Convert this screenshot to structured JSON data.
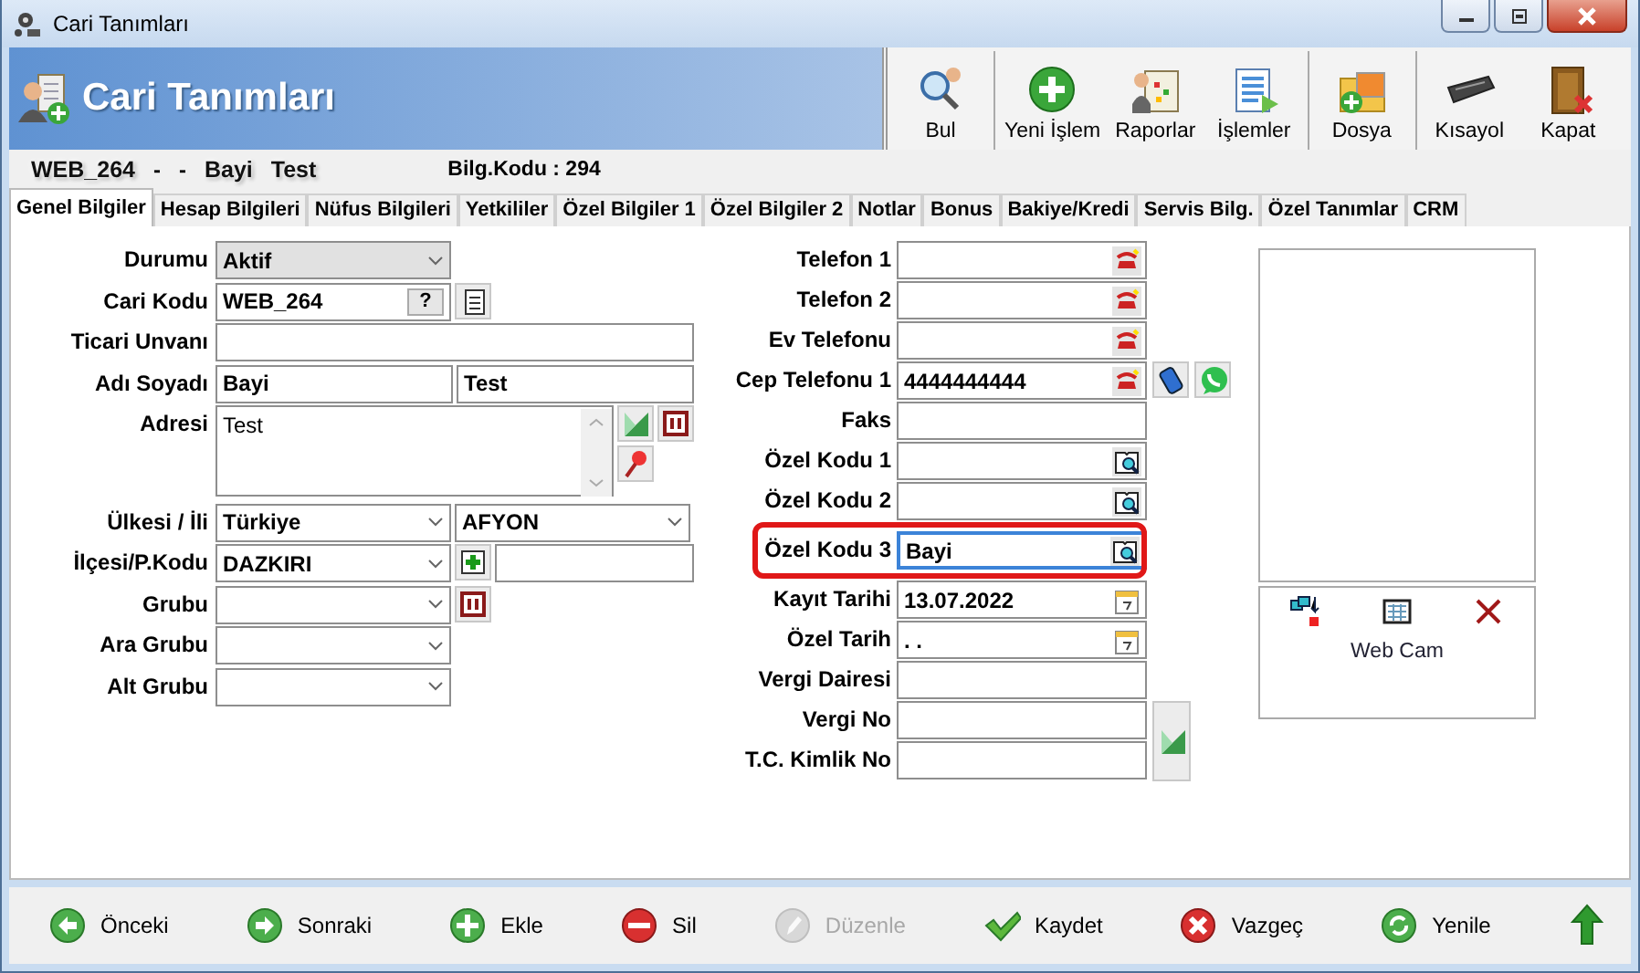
{
  "window": {
    "title": "Cari Tanımları"
  },
  "header": {
    "title": "Cari Tanımları"
  },
  "toolbar_groups": [
    {
      "buttons": [
        {
          "kind": "search",
          "label": "Bul"
        }
      ]
    },
    {
      "buttons": [
        {
          "kind": "add",
          "label": "Yeni İşlem"
        },
        {
          "kind": "report",
          "label": "Raporlar"
        },
        {
          "kind": "list",
          "label": "İşlemler"
        }
      ]
    },
    {
      "buttons": [
        {
          "kind": "file",
          "label": "Dosya"
        }
      ]
    },
    {
      "buttons": [
        {
          "kind": "keyboard",
          "label": "Kısayol"
        },
        {
          "kind": "door",
          "label": "Kapat"
        }
      ]
    }
  ],
  "summary": [
    {
      "kind": "glow",
      "text": "WEB_264"
    },
    {
      "kind": "plain",
      "text": "-"
    },
    {
      "kind": "plain",
      "text": "-"
    },
    {
      "kind": "glow",
      "text": "Bayi"
    },
    {
      "kind": "glow",
      "text": "Test"
    },
    {
      "kind": "info",
      "text": "Bilg.Kodu : 294"
    }
  ],
  "tabs": [
    {
      "label": "Genel Bilgiler",
      "selected": true
    },
    {
      "label": "Hesap Bilgileri",
      "selected": false
    },
    {
      "label": "Nüfus Bilgileri",
      "selected": false
    },
    {
      "label": "Yetkililer",
      "selected": false
    },
    {
      "label": "Özel Bilgiler 1",
      "selected": false
    },
    {
      "label": "Özel Bilgiler 2",
      "selected": false
    },
    {
      "label": "Notlar",
      "selected": false
    },
    {
      "label": "Bonus",
      "selected": false
    },
    {
      "label": "Bakiye/Kredi",
      "selected": false
    },
    {
      "label": "Servis Bilg.",
      "selected": false
    },
    {
      "label": "Özel Tanımlar",
      "selected": false
    },
    {
      "label": "CRM",
      "selected": false
    }
  ],
  "left_form": [
    {
      "label": "Durumu",
      "items": [
        {
          "kind": "select",
          "value": "Aktif",
          "shaded": true
        }
      ]
    },
    {
      "label": "Cari Kodu",
      "items": [
        {
          "kind": "code",
          "value": "WEB_264",
          "button": "?"
        },
        {
          "kind": "doc"
        }
      ]
    },
    {
      "label": "Ticari Unvanı",
      "items": [
        {
          "kind": "text"
        }
      ]
    },
    {
      "label": "Adı Soyadı",
      "items": [
        {
          "kind": "text",
          "value": "Bayi"
        },
        {
          "kind": "text",
          "value": "Test"
        }
      ]
    },
    {
      "label": "Adresi",
      "items": [
        {
          "kind": "memo",
          "value": "Test"
        },
        {
          "kind": "tools"
        }
      ]
    },
    {
      "label": "Ülkesi / İli",
      "items": [
        {
          "kind": "select",
          "value": "Türkiye",
          "shaded": false
        },
        {
          "kind": "select",
          "value": "AFYON",
          "shaded": false
        }
      ]
    },
    {
      "label": "İlçesi/P.Kodu",
      "items": [
        {
          "kind": "select",
          "value": "DAZKIRI",
          "shaded": false
        },
        {
          "kind": "add"
        },
        {
          "kind": "text"
        }
      ]
    },
    {
      "label": "Grubu",
      "items": [
        {
          "kind": "select",
          "shaded": false
        },
        {
          "kind": "pause"
        }
      ]
    },
    {
      "label": "Ara Grubu",
      "items": [
        {
          "kind": "select",
          "shaded": false
        }
      ]
    },
    {
      "label": "Alt Grubu",
      "items": [
        {
          "kind": "select",
          "shaded": false
        }
      ]
    }
  ],
  "middle_form": [
    {
      "label": "Telefon 1",
      "highlighted": false,
      "items": [
        {
          "kind": "phone"
        }
      ]
    },
    {
      "label": "Telefon 2",
      "highlighted": false,
      "items": [
        {
          "kind": "phone"
        }
      ]
    },
    {
      "label": "Ev Telefonu",
      "highlighted": false,
      "items": [
        {
          "kind": "phone"
        }
      ]
    },
    {
      "label": "Cep Telefonu 1",
      "highlighted": false,
      "items": [
        {
          "kind": "phone",
          "value": "4444444444"
        },
        {
          "kind": "mobile"
        },
        {
          "kind": "whatsapp"
        }
      ]
    },
    {
      "label": "Faks",
      "highlighted": false,
      "items": [
        {
          "kind": "text"
        }
      ]
    },
    {
      "label": "Özel Kodu 1",
      "highlighted": false,
      "items": [
        {
          "kind": "lookup",
          "focused": false
        }
      ]
    },
    {
      "label": "Özel Kodu 2",
      "highlighted": false,
      "items": [
        {
          "kind": "lookup",
          "focused": false
        }
      ]
    },
    {
      "label": "Özel Kodu 3",
      "highlighted": true,
      "items": [
        {
          "kind": "lookup",
          "value": "Bayi",
          "focused": true
        }
      ]
    },
    {
      "label": "Kayıt Tarihi",
      "highlighted": false,
      "items": [
        {
          "kind": "date",
          "value": "13.07.2022"
        }
      ]
    },
    {
      "label": "Özel Tarih",
      "highlighted": false,
      "items": [
        {
          "kind": "date",
          "value": ". ."
        }
      ]
    },
    {
      "label": "Vergi Dairesi",
      "highlighted": false,
      "items": [
        {
          "kind": "text"
        }
      ]
    },
    {
      "label": "Vergi No",
      "highlighted": false,
      "items": [
        {
          "kind": "text"
        },
        {
          "kind": "map"
        }
      ]
    },
    {
      "label": "T.C. Kimlik No",
      "highlighted": false,
      "items": [
        {
          "kind": "text"
        }
      ]
    }
  ],
  "webcam": {
    "label": "Web Cam"
  },
  "bottom_buttons": [
    {
      "kind": "prev",
      "label": "Önceki",
      "disabled": false
    },
    {
      "kind": "next",
      "label": "Sonraki",
      "disabled": false
    },
    {
      "kind": "add",
      "label": "Ekle",
      "disabled": false
    },
    {
      "kind": "delete",
      "label": "Sil",
      "disabled": false
    },
    {
      "kind": "edit",
      "label": "Düzenle",
      "disabled": true
    },
    {
      "kind": "save",
      "label": "Kaydet",
      "disabled": false
    },
    {
      "kind": "cancel",
      "label": "Vazgeç",
      "disabled": false
    },
    {
      "kind": "refresh",
      "label": "Yenile",
      "disabled": false
    },
    {
      "kind": "up",
      "disabled": false
    }
  ]
}
